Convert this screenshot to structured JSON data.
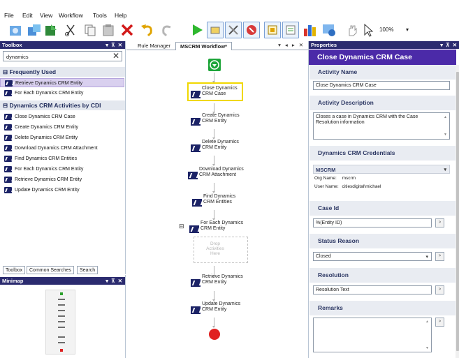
{
  "menu": [
    "File",
    "Edit",
    "View",
    "Workflow",
    "Tools",
    "Help"
  ],
  "toolbar": {
    "zoom": "100%",
    "zoom_caret": "▾"
  },
  "toolbox": {
    "header": "Toolbox",
    "controls": "▾ ⊼ ✕",
    "search_value": "dynamics",
    "search_clear": "✕",
    "frequently_used": {
      "title": "Frequently Used",
      "items": [
        "Retrieve Dynamics CRM Entity",
        "For Each Dynamics CRM Entity"
      ]
    },
    "activities": {
      "title": "Dynamics CRM Activities by CDI",
      "items": [
        "Close Dynamics CRM Case",
        "Create Dynamics CRM Entity",
        "Delete Dynamics CRM Entity",
        "Download Dynamics CRM Attachment",
        "Find Dynamics CRM Entities",
        "For Each Dynamics CRM Entity",
        "Retrieve Dynamics CRM Entity",
        "Update Dynamics CRM Entity"
      ]
    },
    "bottom_tabs": [
      "Toolbox",
      "Common Searches",
      "Search"
    ]
  },
  "minimap": {
    "header": "Minimap",
    "controls": "▾ ⊼ ✕"
  },
  "document": {
    "tabs": [
      "Rule Manager",
      "MSCRM Workflow*"
    ],
    "controls": "▾ ◂ ▸ ✕"
  },
  "workflow": {
    "nodes": [
      {
        "line1": "Close Dynamics",
        "line2": "CRM Case"
      },
      {
        "line1": "Create Dynamics",
        "line2": "CRM Entity"
      },
      {
        "line1": "Delete Dynamics",
        "line2": "CRM Entity"
      },
      {
        "line1": "Download Dynamics",
        "line2": "CRM Attachment"
      },
      {
        "line1": "Find Dynamics",
        "line2": "CRM Entities"
      },
      {
        "line1": "For Each Dynamics",
        "line2": "CRM Entity"
      },
      {
        "line1": "Retrieve Dynamics",
        "line2": "CRM Entity"
      },
      {
        "line1": "Update Dynamics",
        "line2": "CRM Entity"
      }
    ],
    "drop_zone": {
      "line1": "Drop",
      "line2": "Activities",
      "line3": "Here"
    },
    "collapse": "⊟"
  },
  "properties": {
    "header": "Properties",
    "controls": "▾ ⊼ ✕",
    "title": "Close Dynamics CRM Case",
    "activity_name_label": "Activity Name",
    "activity_name_value": "Close Dynamics CRM Case",
    "activity_desc_label": "Activity Description",
    "activity_desc_value": "Closes a case in Dynamics CRM with the Case Resolution information",
    "credentials_label": "Dynamics CRM Credentials",
    "credential_selected": "MSCRM",
    "org_name_label": "Org Name:",
    "org_name_value": "mscrm",
    "user_name_label": "User Name:",
    "user_name_value": "citiesdigital\\michael",
    "case_id_label": "Case Id",
    "case_id_value": "%(Entity ID)",
    "status_reason_label": "Status Reason",
    "status_reason_value": "Closed",
    "resolution_label": "Resolution",
    "resolution_value": "Resolution Text",
    "remarks_label": "Remarks",
    "remarks_value": "",
    "more_button": ">",
    "select_caret": "▾",
    "scroll_up": "▲",
    "scroll_down": "▼"
  },
  "colors": {
    "header_bg": "#2b2b6f",
    "props_title_bg": "#4b2aa8",
    "selection_highlight": "#f0d800"
  }
}
